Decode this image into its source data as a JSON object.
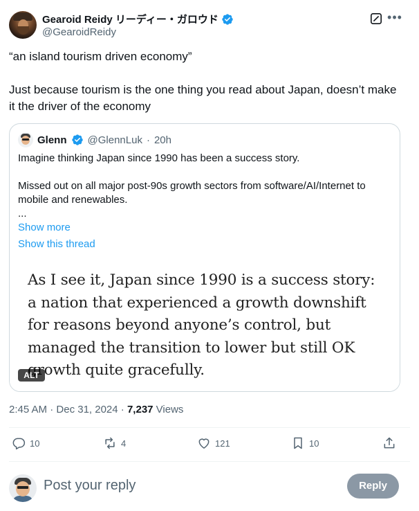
{
  "author": {
    "display_name": "Gearoid Reidy リーディー・ガロウド",
    "handle": "@GearoidReidy",
    "verified": true
  },
  "tweet": {
    "text": "“an island tourism driven economy”\n\nJust because tourism is the one thing you read about Japan, doesn’t make it the driver of the economy"
  },
  "quote": {
    "author_name": "Glenn",
    "author_handle": "@GlennLuk",
    "separator": "·",
    "time": "20h",
    "text": "Imagine thinking Japan since 1990 has been a success story.\n\nMissed out on all major post-90s growth sectors from software/AI/Internet to mobile and renewables.\n...",
    "show_more_label": "Show more",
    "show_thread_label": "Show this thread",
    "image_text": "As I see it, Japan since 1990 is a success story: a nation that experienced a growth downshift for reasons beyond anyone’s control, but managed the transition to lower but still OK growth quite gracefully.",
    "alt_badge": "ALT"
  },
  "meta": {
    "time": "2:45 AM",
    "sep1": " · ",
    "date": "Dec 31, 2024",
    "sep2": " · ",
    "views_count": "7,237",
    "views_label": " Views"
  },
  "actions": {
    "reply_count": "10",
    "repost_count": "4",
    "like_count": "121",
    "bookmark_count": "10"
  },
  "reply_box": {
    "placeholder": "Post your reply",
    "button_label": "Reply"
  },
  "icons": {
    "verified": "verified-badge-icon",
    "grok": "grok-icon",
    "more": "more-icon",
    "reply": "reply-icon",
    "repost": "repost-icon",
    "like": "heart-icon",
    "bookmark": "bookmark-icon",
    "share": "share-icon"
  },
  "colors": {
    "link": "#1d9bf0",
    "verified": "#1d9bf0",
    "secondary_text": "#536471",
    "reply_button": "#8b98a5"
  }
}
